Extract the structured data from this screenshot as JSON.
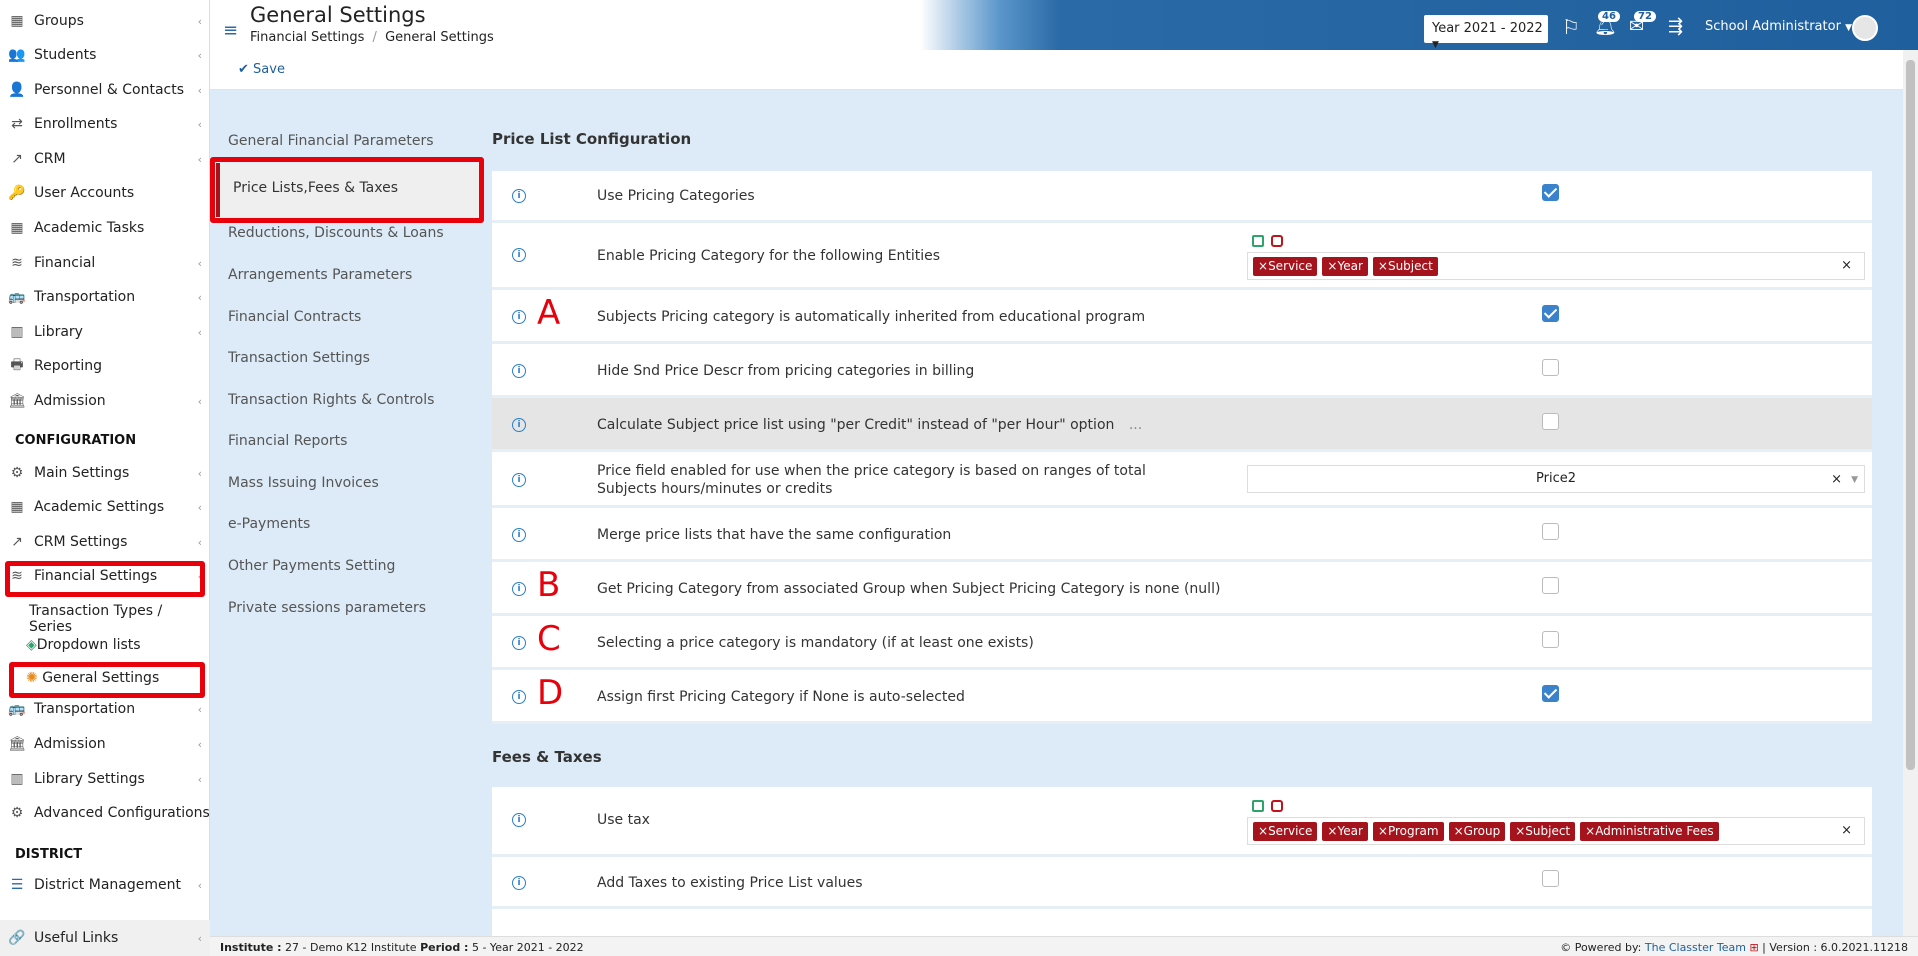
{
  "header": {
    "title": "General Settings",
    "breadcrumb": [
      "Financial Settings",
      "General Settings"
    ],
    "year_select": "Year 2021 - 2022",
    "notif_count": "46",
    "mail_count": "72",
    "user_name": "School Administrator"
  },
  "toolbar": {
    "save_label": "Save"
  },
  "sidebar": {
    "items": [
      {
        "label": "Groups",
        "icon": "groups-icon"
      },
      {
        "label": "Students",
        "icon": "students-icon"
      },
      {
        "label": "Personnel & Contacts",
        "icon": "personnel-icon"
      },
      {
        "label": "Enrollments",
        "icon": "enrollments-icon"
      },
      {
        "label": "CRM",
        "icon": "crm-icon"
      },
      {
        "label": "User Accounts",
        "icon": "user-accounts-icon"
      },
      {
        "label": "Academic Tasks",
        "icon": "academic-tasks-icon"
      },
      {
        "label": "Financial",
        "icon": "financial-icon"
      },
      {
        "label": "Transportation",
        "icon": "transportation-icon"
      },
      {
        "label": "Library",
        "icon": "library-icon"
      },
      {
        "label": "Reporting",
        "icon": "reporting-icon"
      },
      {
        "label": "Admission",
        "icon": "admission-icon"
      }
    ],
    "config_heading": "CONFIGURATION",
    "config_items": [
      {
        "label": "Main Settings"
      },
      {
        "label": "Academic Settings"
      },
      {
        "label": "CRM Settings"
      },
      {
        "label": "Financial Settings"
      }
    ],
    "financial_sub": [
      "Transaction Types / Series",
      "Dropdown lists",
      "General Settings"
    ],
    "config_items2": [
      {
        "label": "Transportation"
      },
      {
        "label": "Admission"
      },
      {
        "label": "Library Settings"
      },
      {
        "label": "Advanced Configurations"
      }
    ],
    "district_heading": "DISTRICT",
    "district_items": [
      {
        "label": "District Management"
      }
    ],
    "useful_links": "Useful Links"
  },
  "settings_menu": [
    "General Financial Parameters",
    "Price Lists,Fees & Taxes",
    "Reductions, Discounts & Loans",
    "Arrangements Parameters",
    "Financial Contracts",
    "Transaction Settings",
    "Transaction Rights & Controls",
    "Financial Reports",
    "Mass Issuing Invoices",
    "e-Payments",
    "Other Payments Setting",
    "Private sessions parameters"
  ],
  "price_section": {
    "title": "Price List Configuration",
    "rows": [
      {
        "label": "Use Pricing Categories",
        "checked": true
      },
      {
        "label": "Enable Pricing Category for the following Entities",
        "tags": [
          "Service",
          "Year",
          "Subject"
        ]
      },
      {
        "label": "Subjects Pricing category is automatically inherited from educational program",
        "checked": true,
        "marker": "A"
      },
      {
        "label": "Hide Snd Price Descr from pricing categories in billing",
        "checked": false
      },
      {
        "label": "Calculate Subject price list using \"per Credit\" instead of \"per Hour\" option",
        "checked": false,
        "ellipsis": "..."
      },
      {
        "label": "Price field enabled for use when the price category is based on ranges of total Subjects hours/minutes or credits",
        "select": "Price2"
      },
      {
        "label": "Merge price lists that have the same configuration",
        "checked": false
      },
      {
        "label": "Get Pricing Category from associated Group when Subject Pricing Category is none (null)",
        "checked": false,
        "marker": "B"
      },
      {
        "label": "Selecting a price category is mandatory (if at least one exists)",
        "checked": false,
        "marker": "C"
      },
      {
        "label": "Assign first Pricing Category if None is auto-selected",
        "checked": true,
        "marker": "D"
      }
    ]
  },
  "fees_section": {
    "title": "Fees & Taxes",
    "rows": [
      {
        "label": "Use tax",
        "tags": [
          "Service",
          "Year",
          "Program",
          "Group",
          "Subject",
          "Administrative Fees"
        ]
      },
      {
        "label": "Add Taxes to existing Price List values",
        "checked": false
      }
    ]
  },
  "footer": {
    "institute_label": "Institute :",
    "institute_value": "27 - Demo K12 Institute",
    "period_label": "Period :",
    "period_value": "5 - Year 2021 - 2022",
    "powered_label": "Powered by:",
    "powered_value": "The Classter Team",
    "version": "| Version : 6.0.2021.11218"
  },
  "colors": {
    "accent": "#1f5f9d",
    "highlight": "#e8000b",
    "tag": "#a5141c",
    "check": "#3a83cc"
  }
}
